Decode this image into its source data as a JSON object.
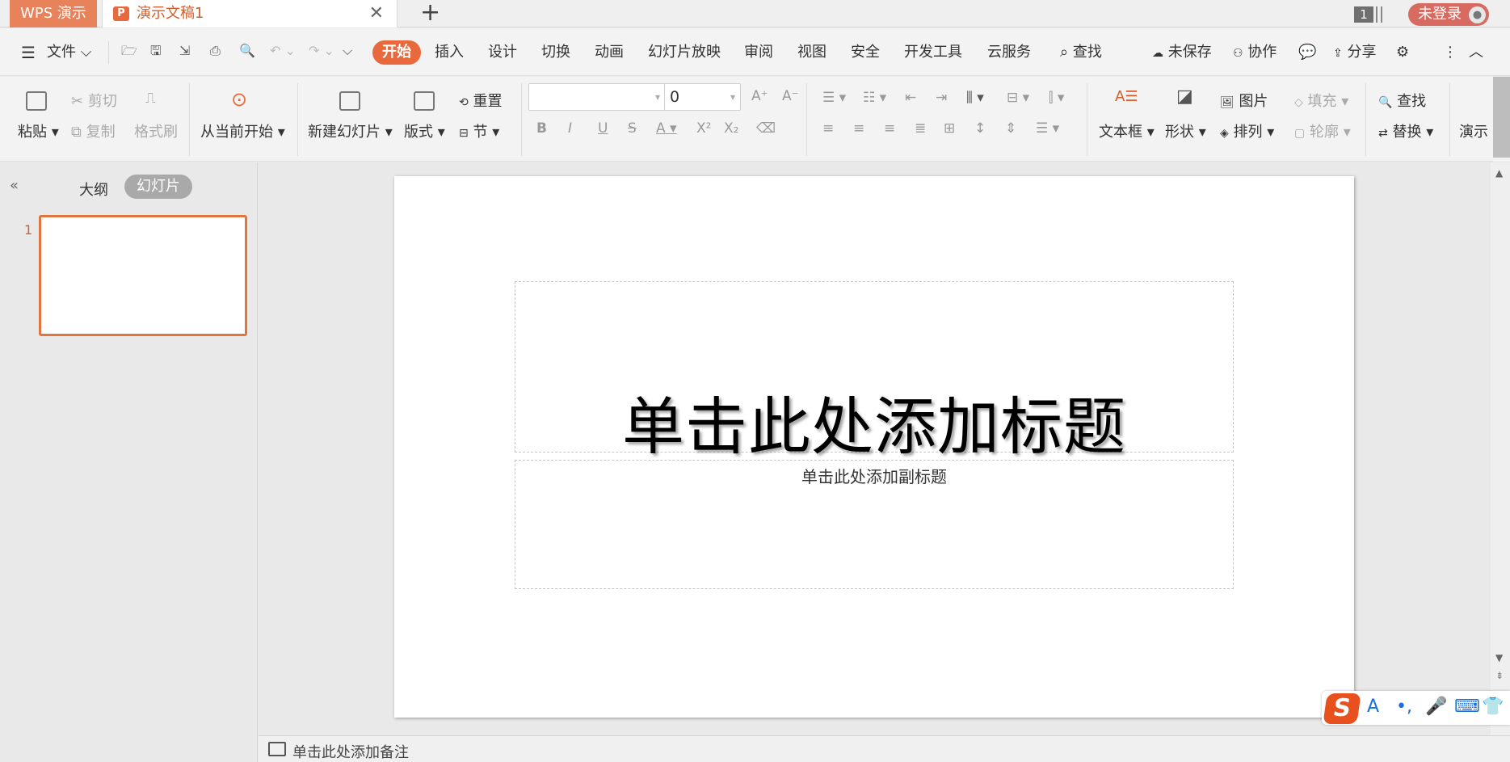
{
  "titlebar": {
    "app_tab": "WPS 演示",
    "doc_tab": "演示文稿1",
    "doc_icon": "P",
    "close": "✕",
    "new_tab": "+",
    "window_count": "1",
    "login": "未登录",
    "avatar_icon": "user-icon"
  },
  "menu": {
    "file": "文件",
    "tabs": [
      "开始",
      "插入",
      "设计",
      "切换",
      "动画",
      "幻灯片放映",
      "审阅",
      "视图",
      "安全",
      "开发工具",
      "云服务"
    ],
    "search": "查找",
    "unsaved": "未保存",
    "collab": "协作",
    "share": "分享"
  },
  "ribbon": {
    "paste": "粘贴",
    "cut": "剪切",
    "copy": "复制",
    "format_painter": "格式刷",
    "play_from_current": "从当前开始",
    "new_slide": "新建幻灯片",
    "layout": "版式",
    "reset": "重置",
    "section": "节",
    "font_name": "",
    "font_size": "0",
    "textbox": "文本框",
    "shape": "形状",
    "picture": "图片",
    "arrange": "排列",
    "fill": "填充",
    "outline": "轮廓",
    "find": "查找",
    "replace": "替换",
    "present": "演示"
  },
  "left_panel": {
    "outline_tab": "大纲",
    "slides_tab": "幻灯片",
    "slide_number": "1"
  },
  "slide": {
    "title_placeholder": "单击此处添加标题",
    "subtitle_placeholder": "单击此处添加副标题"
  },
  "notes": {
    "placeholder": "单击此处添加备注"
  },
  "ime": {
    "logo": "S",
    "glyphs": [
      "A",
      "•,",
      "🎤",
      "⌨",
      "👕"
    ]
  },
  "colors": {
    "accent": "#e8693b",
    "app_tab": "#e8825b",
    "login": "#d76b61"
  }
}
